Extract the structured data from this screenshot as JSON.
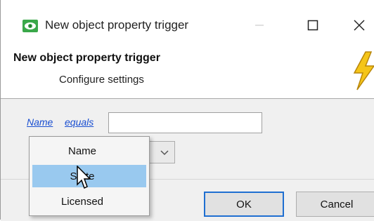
{
  "window": {
    "title": "New object property trigger",
    "icon": "eye-icon",
    "controls": {
      "minimize": "—",
      "maximize": "☐",
      "close": "✕"
    }
  },
  "header": {
    "title": "New object property trigger",
    "subtitle": "Configure settings",
    "icon": "lightning-bolt-icon"
  },
  "condition": {
    "property_link": "Name",
    "operator_link": "equals",
    "value": ""
  },
  "dropdown": {
    "options": [
      "Name",
      "State",
      "Licensed"
    ],
    "highlighted": "State"
  },
  "buttons": {
    "ok": "OK",
    "cancel": "Cancel"
  },
  "colors": {
    "link": "#1a4fd1",
    "highlight": "#99c9ef",
    "ok_border": "#1f6fd1"
  }
}
